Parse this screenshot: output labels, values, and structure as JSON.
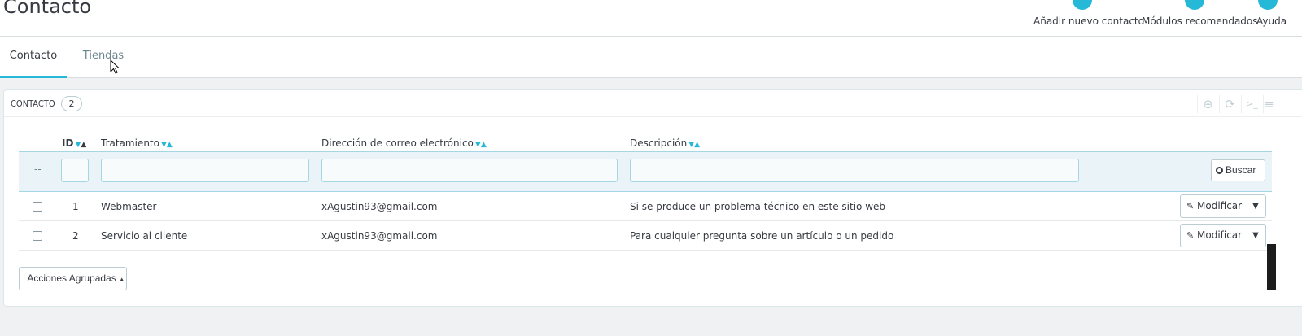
{
  "header": {
    "title": "Contacto",
    "toolbar": [
      {
        "label": "Añadir nuevo contacto",
        "icon": "add-circle-icon"
      },
      {
        "label": "Módulos recomendados",
        "icon": "puzzle-icon"
      },
      {
        "label": "Ayuda",
        "icon": "help-icon"
      }
    ]
  },
  "tabs": [
    {
      "label": "Contacto",
      "active": true
    },
    {
      "label": "Tiendas",
      "active": false
    }
  ],
  "panel": {
    "title": "CONTACTO",
    "count": "2",
    "heading_icons": [
      "add-icon",
      "refresh-icon",
      "sql-query-icon",
      "export-icon"
    ]
  },
  "table": {
    "columns": [
      "ID",
      "Tratamiento",
      "Dirección de correo electrónico",
      "Descripción"
    ],
    "filter_dash": "--",
    "search_button": "Buscar",
    "rows": [
      {
        "id": "1",
        "title": "Webmaster",
        "email": "xAgustin93@gmail.com",
        "description": "Si se produce un problema técnico en este sitio web",
        "action": "Modificar"
      },
      {
        "id": "2",
        "title": "Servicio al cliente",
        "email": "xAgustin93@gmail.com",
        "description": "Para cualquier pregunta sobre un artículo o un pedido",
        "action": "Modificar"
      }
    ]
  },
  "bulk_actions": {
    "label": "Acciones Agrupadas"
  },
  "colors": {
    "accent": "#25b9d7",
    "text": "#363a41",
    "background": "#eff1f2",
    "filter_bg": "#eaf4f8"
  }
}
